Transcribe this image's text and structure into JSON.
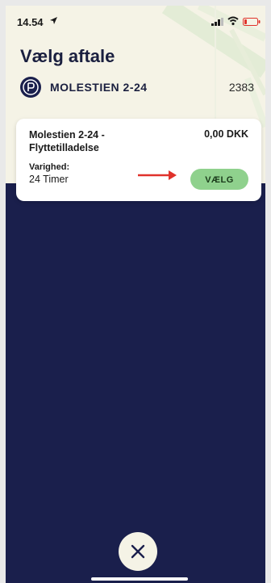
{
  "status_bar": {
    "time": "14.54"
  },
  "page": {
    "title": "Vælg aftale"
  },
  "location": {
    "name": "MOLESTIEN 2-24",
    "code": "2383"
  },
  "agreement_card": {
    "title": "Molestien 2-24 - Flyttetilladelse",
    "price": "0,00 DKK",
    "duration_label": "Varighed:",
    "duration_value": "24 Timer",
    "select_label": "VÆLG"
  },
  "colors": {
    "background": "#1a1f4c",
    "header": "#f5f3e6",
    "select_button": "#8fd18d",
    "annotation_arrow": "#e0322b"
  },
  "icons": {
    "location_arrow": "location-arrow-icon",
    "signal": "signal-icon",
    "wifi": "wifi-icon",
    "battery": "battery-icon",
    "parking": "parking-icon",
    "close": "close-icon"
  }
}
